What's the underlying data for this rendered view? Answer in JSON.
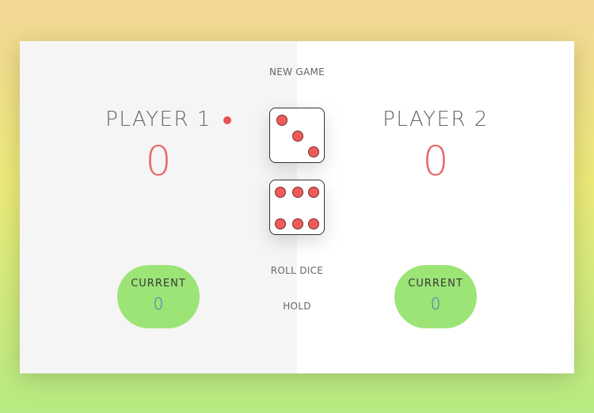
{
  "controls": {
    "new_game": "NEW GAME",
    "roll_dice": "ROLL DICE",
    "hold": "HOLD"
  },
  "players": [
    {
      "name": "PLAYER 1",
      "score": "0",
      "current_label": "CURRENT",
      "current_score": "0",
      "active": true
    },
    {
      "name": "PLAYER 2",
      "score": "0",
      "current_label": "CURRENT",
      "current_score": "0",
      "active": false
    }
  ],
  "dice": [
    3,
    6
  ],
  "colors": {
    "active_dot": "#e65252",
    "score": "#e66a6a",
    "current_box": "#9ce476",
    "current_score": "#4a6fd1",
    "pip": "#ef5b5b"
  }
}
